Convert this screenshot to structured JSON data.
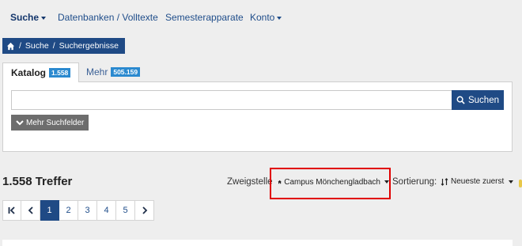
{
  "topnav": {
    "items": [
      {
        "label": "Suche",
        "has_caret": true,
        "active": true
      },
      {
        "label": "Datenbanken / Volltexte",
        "has_caret": false
      },
      {
        "label": "Semesterapparate",
        "has_caret": false
      },
      {
        "label": "Konto",
        "has_caret": true
      }
    ]
  },
  "breadcrumb": {
    "home_icon": "home-icon",
    "sep": "/",
    "items": [
      "Suche",
      "Suchergebnisse"
    ]
  },
  "tabs": [
    {
      "label": "Katalog",
      "count": "1.558",
      "active": true
    },
    {
      "label": "Mehr",
      "count": "505.159",
      "active": false
    }
  ],
  "search": {
    "value": "",
    "button_label": "Suchen",
    "button_icon": "search-icon",
    "more_fields_label": "Mehr Suchfelder",
    "more_fields_icon": "chevron-down-icon"
  },
  "results": {
    "hits_label": "1.558 Treffer",
    "branch_label": "Zweigstelle",
    "branch_value": "Campus Mönchengladbach",
    "branch_icon": "home-icon",
    "sort_label": "Sortierung:",
    "sort_value": "Neueste zuerst",
    "sort_icon": "sort-icon"
  },
  "pagination": {
    "first_icon": "first-page-icon",
    "prev_icon": "prev-page-icon",
    "next_icon": "next-page-icon",
    "pages": [
      "1",
      "2",
      "3",
      "4",
      "5"
    ],
    "current": "1"
  },
  "colors": {
    "brand": "#1f4a85",
    "badge": "#2a89cf",
    "highlight": "#e00000",
    "background": "#eeeeee"
  }
}
